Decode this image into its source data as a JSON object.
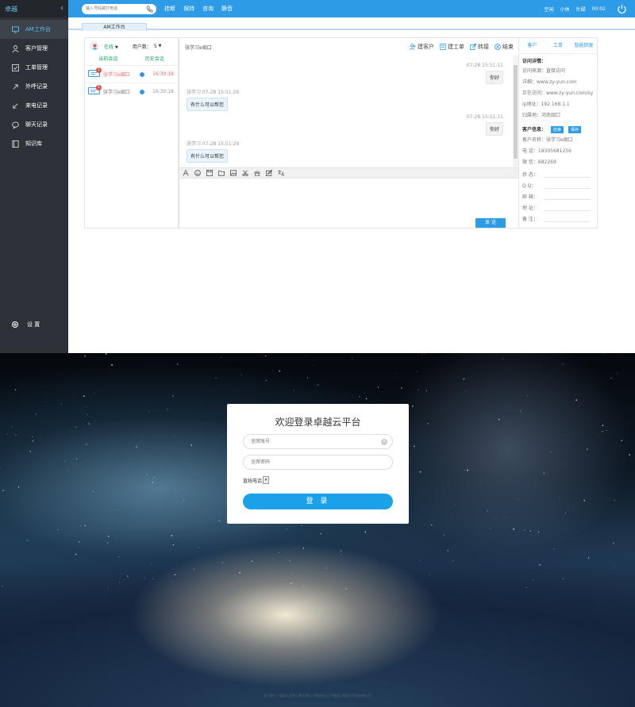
{
  "sidebar": {
    "brand": "卓越",
    "collapse_glyph": "‹",
    "items": [
      {
        "label": "AM工作台",
        "icon": "monitor-icon"
      },
      {
        "label": "客户管理",
        "icon": "user-icon"
      },
      {
        "label": "工单管理",
        "icon": "checkbox-icon"
      },
      {
        "label": "外呼记录",
        "icon": "arrow-up-right-icon"
      },
      {
        "label": "来电记录",
        "icon": "arrow-down-left-icon"
      },
      {
        "label": "聊天记录",
        "icon": "chat-icon"
      },
      {
        "label": "知识库",
        "icon": "book-icon"
      }
    ],
    "settings_label": "设 置"
  },
  "topbar": {
    "search_placeholder": "输入号码拨打电话",
    "actions": [
      "挂断",
      "保持",
      "咨询",
      "静音"
    ],
    "status": [
      "空闲",
      "小休",
      "忙碌"
    ],
    "timer": "00:02"
  },
  "tabs": {
    "active": "AM工作台"
  },
  "sessions": {
    "status": "在线",
    "user_count_label": "用户数：",
    "user_count": "5",
    "tab_current": "当前会话",
    "tab_history": "历史会话",
    "items": [
      {
        "name": "张学习e闽口",
        "time": "16:30:18",
        "badge": "1",
        "unread": true
      },
      {
        "name": "张学习e闽口",
        "time": "16:30:18",
        "badge": "1",
        "unread": false
      }
    ]
  },
  "chat": {
    "contact": "张学习e闽口",
    "actions": [
      "建客户",
      "建工单",
      "转接",
      "结束"
    ],
    "messages": [
      {
        "side": "mine",
        "meta": "07-28 15:51:11",
        "text": "你好"
      },
      {
        "side": "theirs",
        "meta": "张学习 07-28 15:51:29",
        "text": "有什么可以帮您"
      },
      {
        "side": "mine",
        "meta": "07-28 15:51:11",
        "text": "你好"
      },
      {
        "side": "theirs",
        "meta": "张学习 07-28 15:51:29",
        "text": "有什么可以帮您"
      }
    ],
    "toolbar": [
      "font-icon",
      "emoji-icon",
      "save-icon",
      "folder-icon",
      "image-icon",
      "cut-icon",
      "phone-icon",
      "edit-icon",
      "translate-icon"
    ],
    "send_label": "发 送"
  },
  "info": {
    "tabs": [
      "客户",
      "工单",
      "智能回复"
    ],
    "visit_title": "访问详情：",
    "visit": [
      "访问来源：直接访问",
      "详细：www.zy-yun.com",
      "正在访问：www.zy-yun.com/sy",
      "ip地址：192.168.1.1",
      "归属地：河南闽口"
    ],
    "customer_title": "客户信息：",
    "btn_search": "检索",
    "btn_save": "保存",
    "customer": [
      "客户名称：张学习e闽口",
      "电 话：18305681256",
      "微 信：682269"
    ],
    "fields": [
      "状 态：",
      "Q Q：",
      "邮 箱：",
      "地 址：",
      "备 注："
    ]
  },
  "login": {
    "title": "欢迎登录卓越云平台",
    "account_placeholder": "坐席账号",
    "password_placeholder": "坐席密码",
    "mode": "直线电话",
    "button": "登 录",
    "footer": "关于我们 | 服务与支持 | 联系我们 | 帮助中心 | 卓越云 | 版权©科技有限公司"
  }
}
